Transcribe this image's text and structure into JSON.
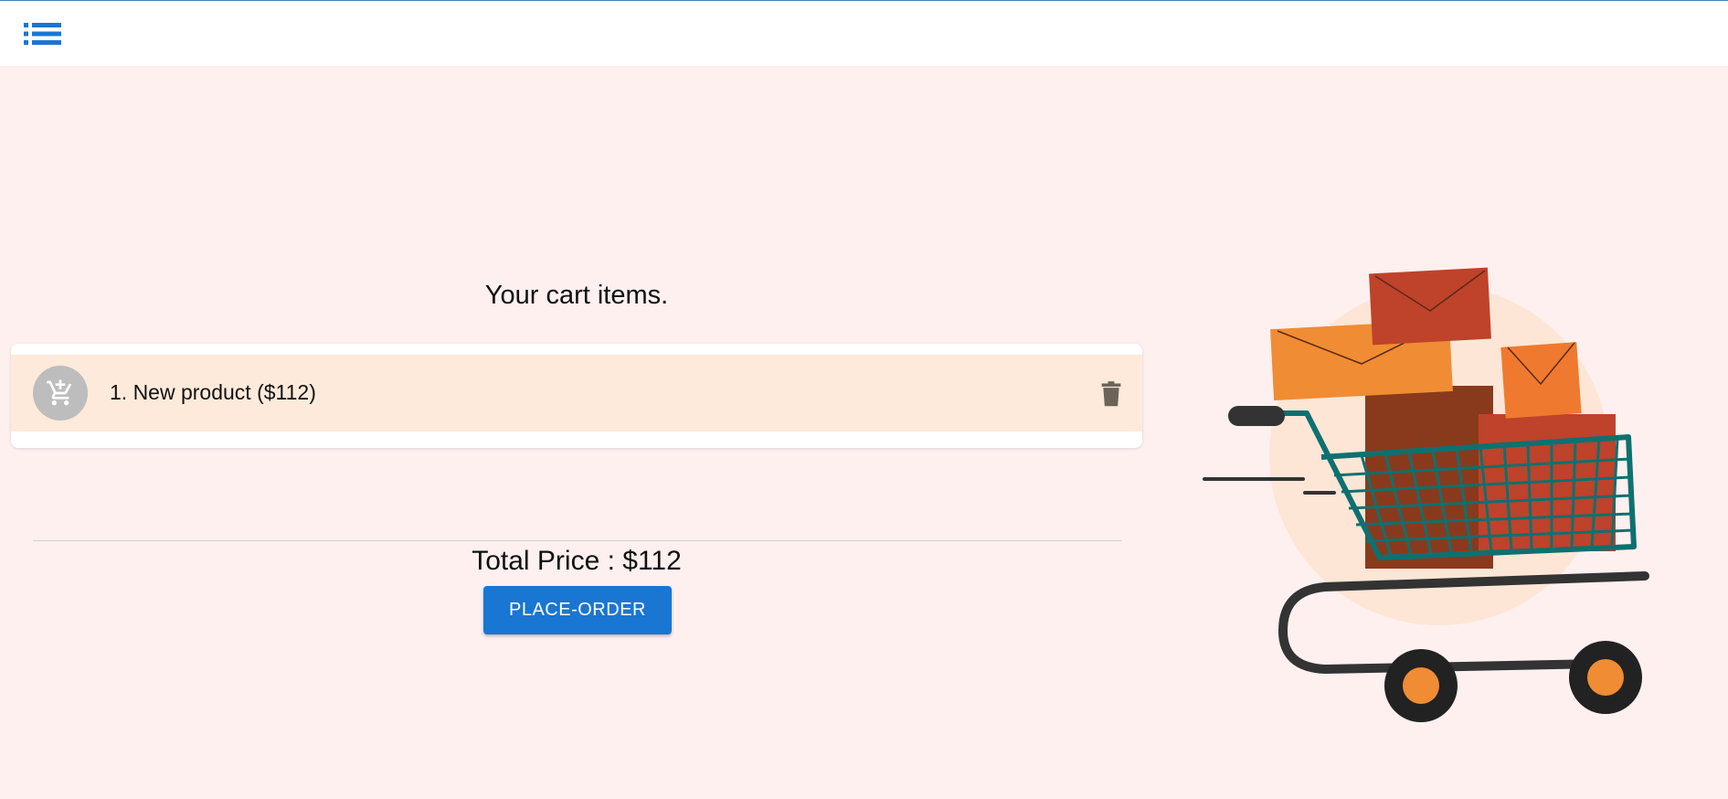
{
  "header": {
    "menu_icon": "list-icon",
    "accent_color": "#1976d2"
  },
  "cart": {
    "title": "Your cart items.",
    "items": [
      {
        "label": "1. New product ($112)",
        "icon": "add-shopping-cart-icon",
        "delete_icon": "trash-icon"
      }
    ],
    "total_label": "Total Price : $112",
    "place_order_label": "PLACE-ORDER"
  },
  "illustration": {
    "subject": "shopping-cart-with-packages"
  }
}
